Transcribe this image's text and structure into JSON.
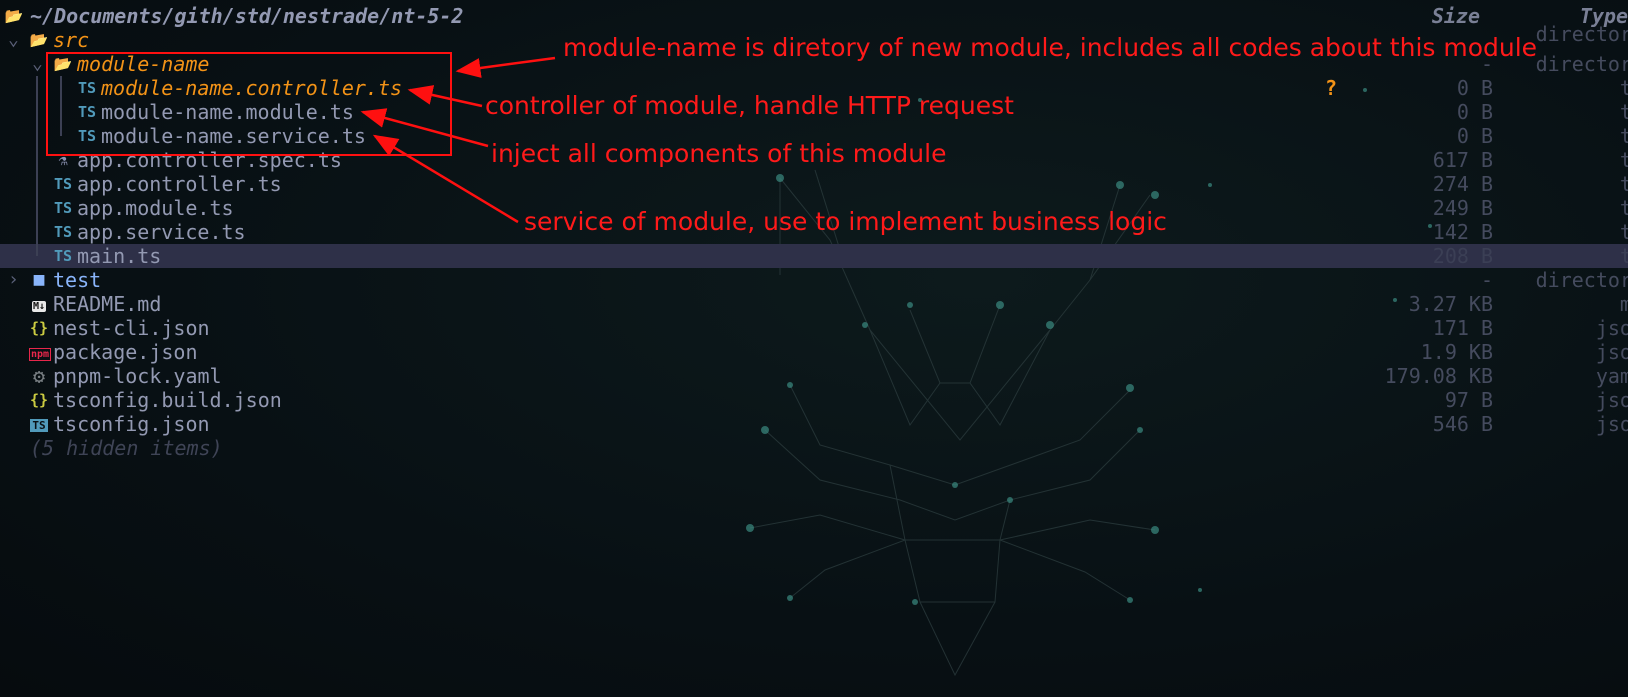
{
  "header": {
    "path": "~/Documents/gith/std/nestrade/nt-5-2",
    "size_label": "Size",
    "type_label": "Type"
  },
  "rows": [
    {
      "name": "src",
      "size": "",
      "type": "directory",
      "icon": "folder-open-icon"
    },
    {
      "name": "module-name",
      "size": "-",
      "type": "directory",
      "icon": "folder-open-icon"
    },
    {
      "name": "module-name.controller.ts",
      "size": "0 B",
      "type": "ts",
      "icon": "typescript-icon",
      "git_status": "?"
    },
    {
      "name": "module-name.module.ts",
      "size": "0 B",
      "type": "ts",
      "icon": "typescript-icon"
    },
    {
      "name": "module-name.service.ts",
      "size": "0 B",
      "type": "ts",
      "icon": "typescript-icon"
    },
    {
      "name": "app.controller.spec.ts",
      "size": "617 B",
      "type": "ts",
      "icon": "flask-icon"
    },
    {
      "name": "app.controller.ts",
      "size": "274 B",
      "type": "ts",
      "icon": "typescript-icon"
    },
    {
      "name": "app.module.ts",
      "size": "249 B",
      "type": "ts",
      "icon": "typescript-icon"
    },
    {
      "name": "app.service.ts",
      "size": "142 B",
      "type": "ts",
      "icon": "typescript-icon"
    },
    {
      "name": "main.ts",
      "size": "208 B",
      "type": "ts",
      "icon": "typescript-icon"
    },
    {
      "name": "test",
      "size": "-",
      "type": "directory",
      "icon": "folder-icon"
    },
    {
      "name": "README.md",
      "size": "3.27 KB",
      "type": "md",
      "icon": "markdown-icon"
    },
    {
      "name": "nest-cli.json",
      "size": "171 B",
      "type": "json",
      "icon": "json-icon"
    },
    {
      "name": "package.json",
      "size": "1.9 KB",
      "type": "json",
      "icon": "npm-icon"
    },
    {
      "name": "pnpm-lock.yaml",
      "size": "179.08 KB",
      "type": "yaml",
      "icon": "gear-icon"
    },
    {
      "name": "tsconfig.build.json",
      "size": "97 B",
      "type": "json",
      "icon": "json-icon"
    },
    {
      "name": "tsconfig.json",
      "size": "546 B",
      "type": "json",
      "icon": "tsconfig-icon"
    }
  ],
  "hidden_items": "(5 hidden items)",
  "annotations": [
    "module-name is diretory of new module, includes all codes about this module",
    "controller of module, handle HTTP request",
    "inject all components of this module",
    "service of module, use to implement business logic"
  ],
  "colors": {
    "accent": "#f39317",
    "annotation": "#ff1a1a",
    "highlight": "#2e3048",
    "folder": "#89b4fa",
    "ts": "#519aba"
  }
}
